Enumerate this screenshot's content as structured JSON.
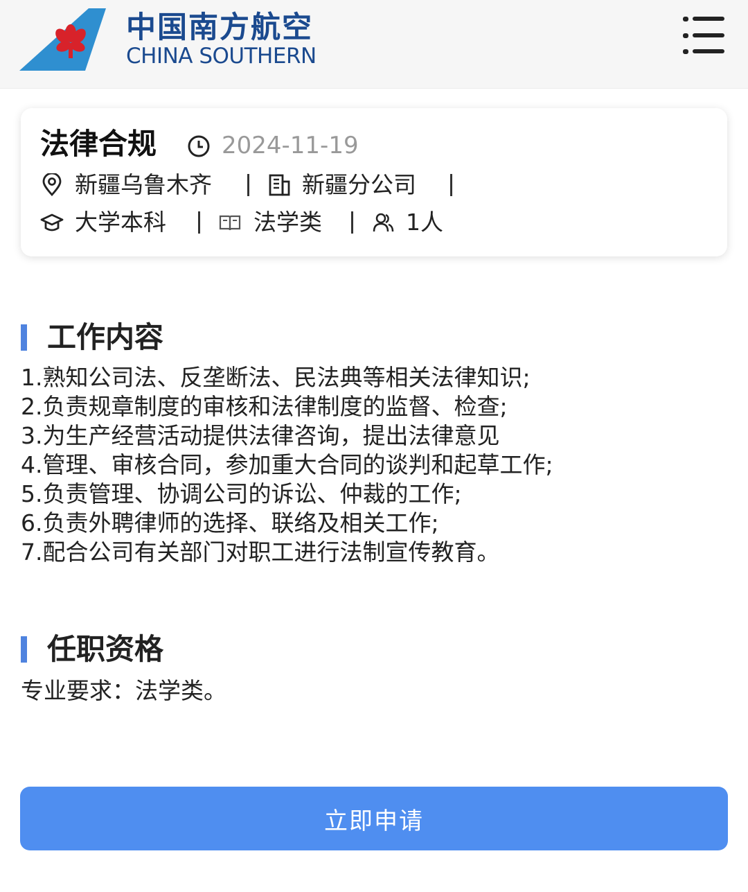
{
  "header": {
    "brand_cn": "中国南方航空",
    "brand_en": "CHINA SOUTHERN",
    "logo_icon": "china-southern-kapok-logo",
    "menu_icon": "menu-icon",
    "colors": {
      "brand": "#1b4a8f",
      "logo_blue": "#2f8fd0",
      "logo_red": "#d8222a"
    }
  },
  "job": {
    "title": "法律合规",
    "date": "2024-11-19",
    "location": "新疆乌鲁木齐",
    "company": "新疆分公司",
    "education": "大学本科",
    "major": "法学类",
    "headcount": "1人"
  },
  "duties": {
    "title": "工作内容",
    "items": [
      "1.熟知公司法、反垄断法、民法典等相关法律知识;",
      "2.负责规章制度的审核和法律制度的监督、检查;",
      "3.为生产经营活动提供法律咨询，提出法律意见",
      "4.管理、审核合同，参加重大合同的谈判和起草工作;",
      "5.负责管理、协调公司的诉讼、仲裁的工作;",
      "6.负责外聘律师的选择、联络及相关工作;",
      "7.配合公司有关部门对职工进行法制宣传教育。"
    ]
  },
  "requirements": {
    "title": "任职资格",
    "text": "专业要求：法学类。"
  },
  "apply_button": {
    "label": "立即申请",
    "color": "#4f8ef0"
  },
  "accent_color": "#4f83df"
}
